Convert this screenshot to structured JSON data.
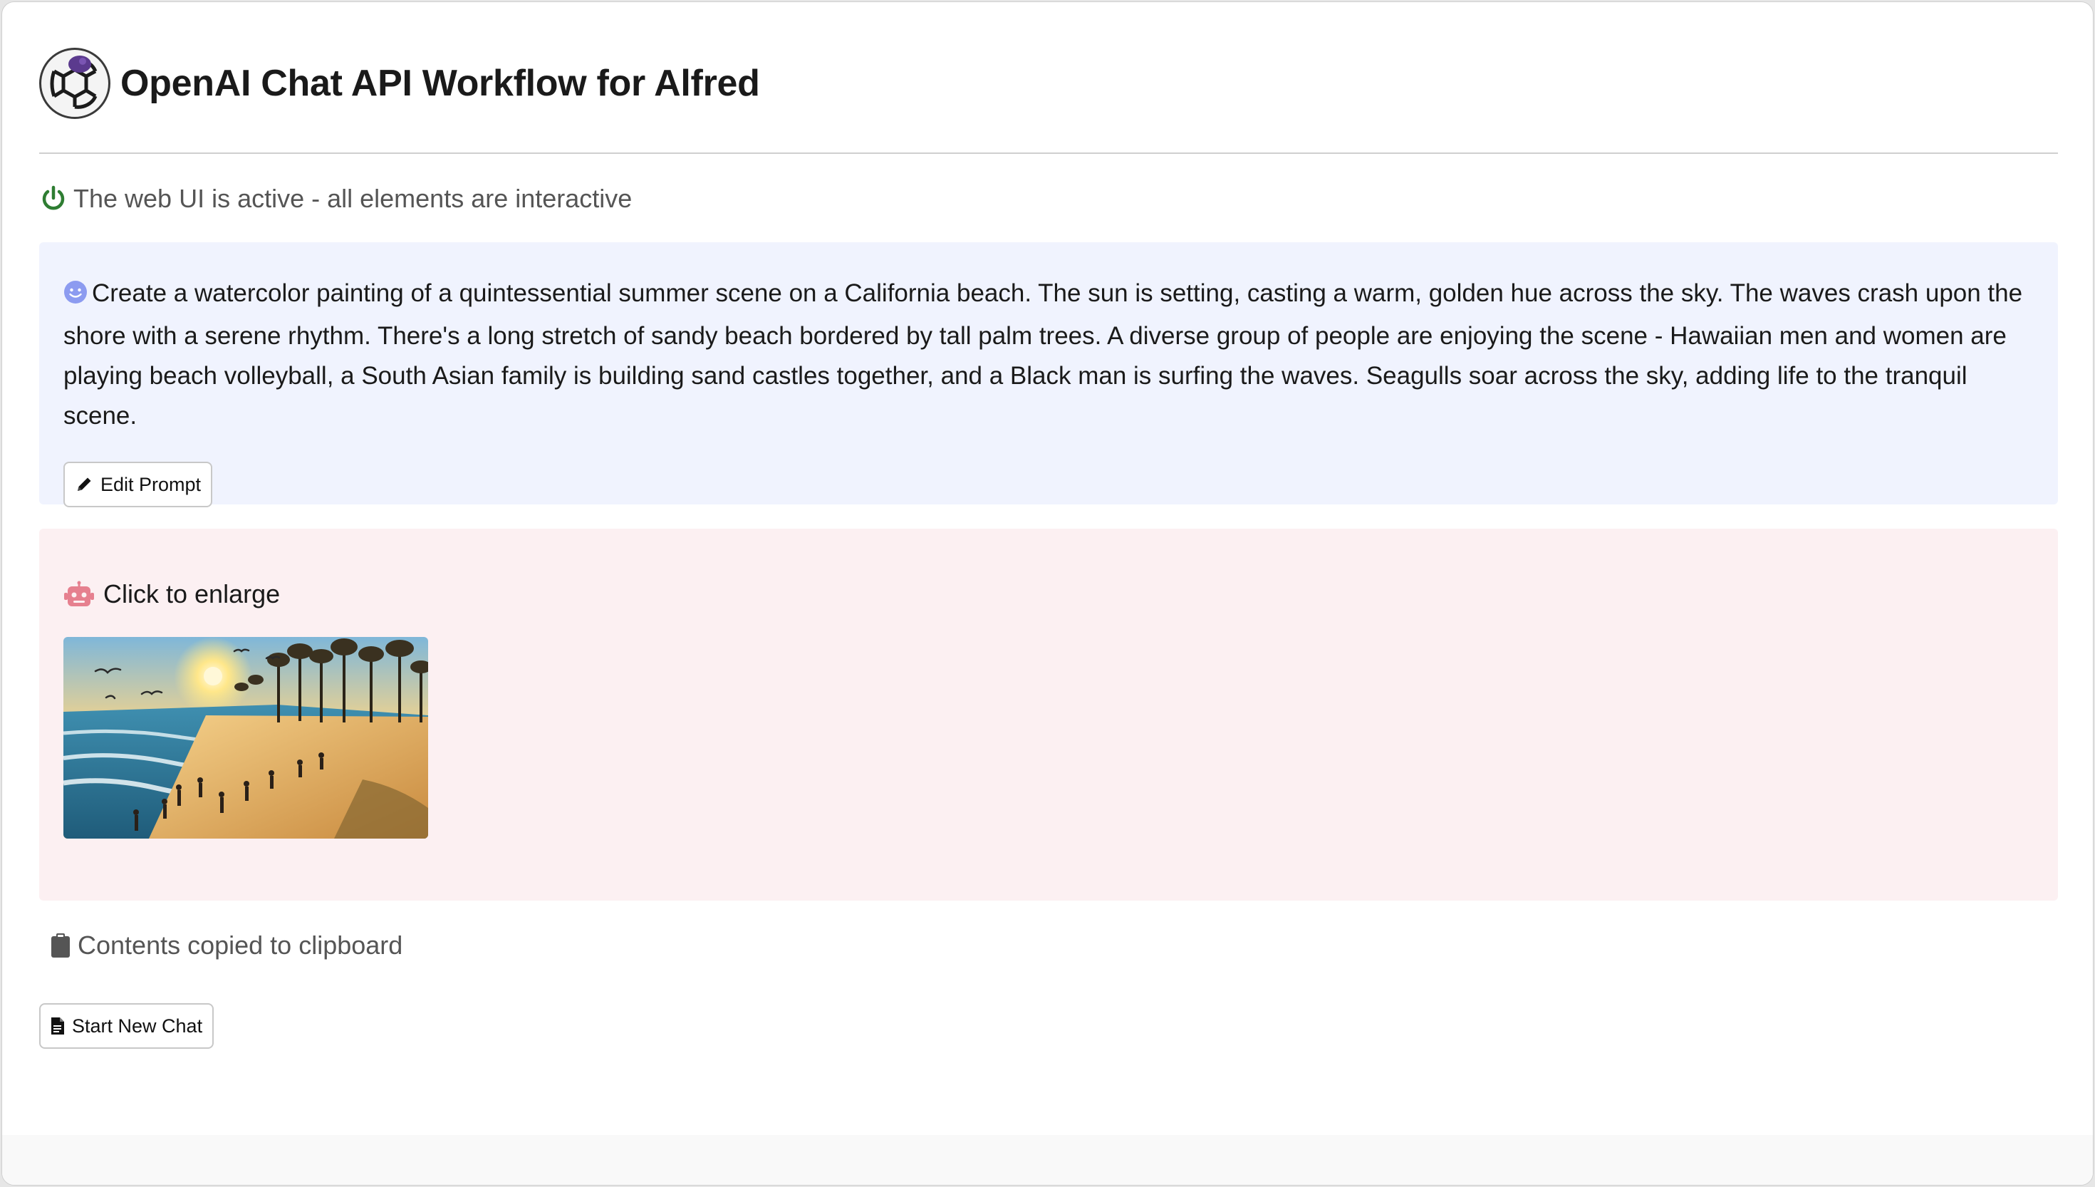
{
  "header": {
    "title": "OpenAI Chat API Workflow for Alfred",
    "logo_icon": "openai-logo-icon"
  },
  "status": {
    "text": "The web UI is active - all elements are interactive",
    "icon": "power-icon",
    "color": "#2e7d32"
  },
  "user_message": {
    "icon": "user-face-icon",
    "text": "Create a watercolor painting of a quintessential summer scene on a California beach. The sun is setting, casting a warm, golden hue across the sky. The waves crash upon the shore with a serene rhythm. There's a long stretch of sandy beach bordered by tall palm trees. A diverse group of people are enjoying the scene - Hawaiian men and women are playing beach volleyball, a South Asian family is building sand castles together, and a Black man is surfing the waves. Seagulls soar across the sky, adding life to the tranquil scene.",
    "edit_button": {
      "label": "Edit Prompt",
      "icon": "pencil-icon"
    },
    "background": "#f0f3fe"
  },
  "assistant_message": {
    "icon": "robot-icon",
    "label": "Click to enlarge",
    "image_icon": "beach-watercolor-thumbnail",
    "background": "#fcf0f2"
  },
  "clipboard": {
    "icon": "clipboard-icon",
    "text": "Contents copied to clipboard"
  },
  "new_chat_button": {
    "label": "Start New Chat",
    "icon": "document-icon"
  }
}
